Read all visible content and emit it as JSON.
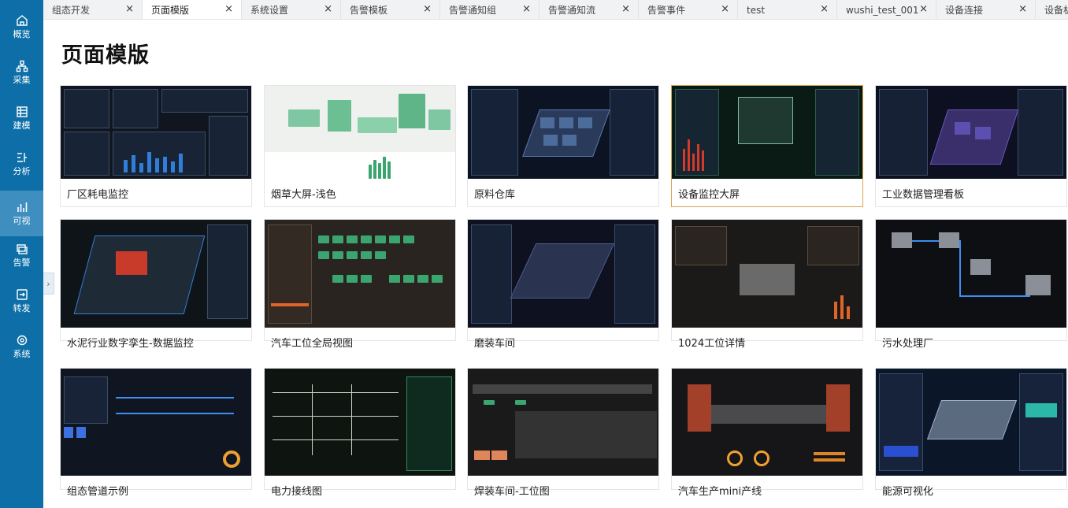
{
  "sidebar": {
    "items": [
      {
        "label": "概览",
        "icon": "home-icon"
      },
      {
        "label": "采集",
        "icon": "network-icon"
      },
      {
        "label": "建模",
        "icon": "table-icon"
      },
      {
        "label": "分析",
        "icon": "analysis-icon"
      },
      {
        "label": "可视",
        "icon": "chart-icon",
        "active": true
      },
      {
        "label": "告警",
        "icon": "alarm-icon"
      },
      {
        "label": "转发",
        "icon": "forward-icon"
      },
      {
        "label": "系统",
        "icon": "settings-icon"
      }
    ],
    "collapse_glyph": "›"
  },
  "tabs": [
    {
      "label": "组态开发"
    },
    {
      "label": "页面模版",
      "active": true
    },
    {
      "label": "系统设置"
    },
    {
      "label": "告警模板"
    },
    {
      "label": "告警通知组"
    },
    {
      "label": "告警通知流"
    },
    {
      "label": "告警事件"
    },
    {
      "label": "test"
    },
    {
      "label": "wushi_test_001"
    },
    {
      "label": "设备连接"
    },
    {
      "label": "设备机"
    }
  ],
  "tab_close_glyph": "×",
  "page": {
    "title": "页面模版"
  },
  "templates": [
    {
      "label": "厂区耗电监控"
    },
    {
      "label": "烟草大屏-浅色"
    },
    {
      "label": "原料仓库"
    },
    {
      "label": "设备监控大屏",
      "selected": true
    },
    {
      "label": "工业数据管理看板"
    },
    {
      "label": "水泥行业数字孪生-数据监控"
    },
    {
      "label": "汽车工位全局视图"
    },
    {
      "label": "磨装车间"
    },
    {
      "label": "1024工位详情"
    },
    {
      "label": "污水处理厂"
    },
    {
      "label": "组态管道示例"
    },
    {
      "label": "电力接线图"
    },
    {
      "label": "焊装车间-工位图"
    },
    {
      "label": "汽车生产mini产线"
    },
    {
      "label": "能源可视化"
    }
  ],
  "colors": {
    "sidebar": "#0e6fa8",
    "sidebar_active": "#3f8ec0",
    "selected_border": "#d9a450"
  }
}
